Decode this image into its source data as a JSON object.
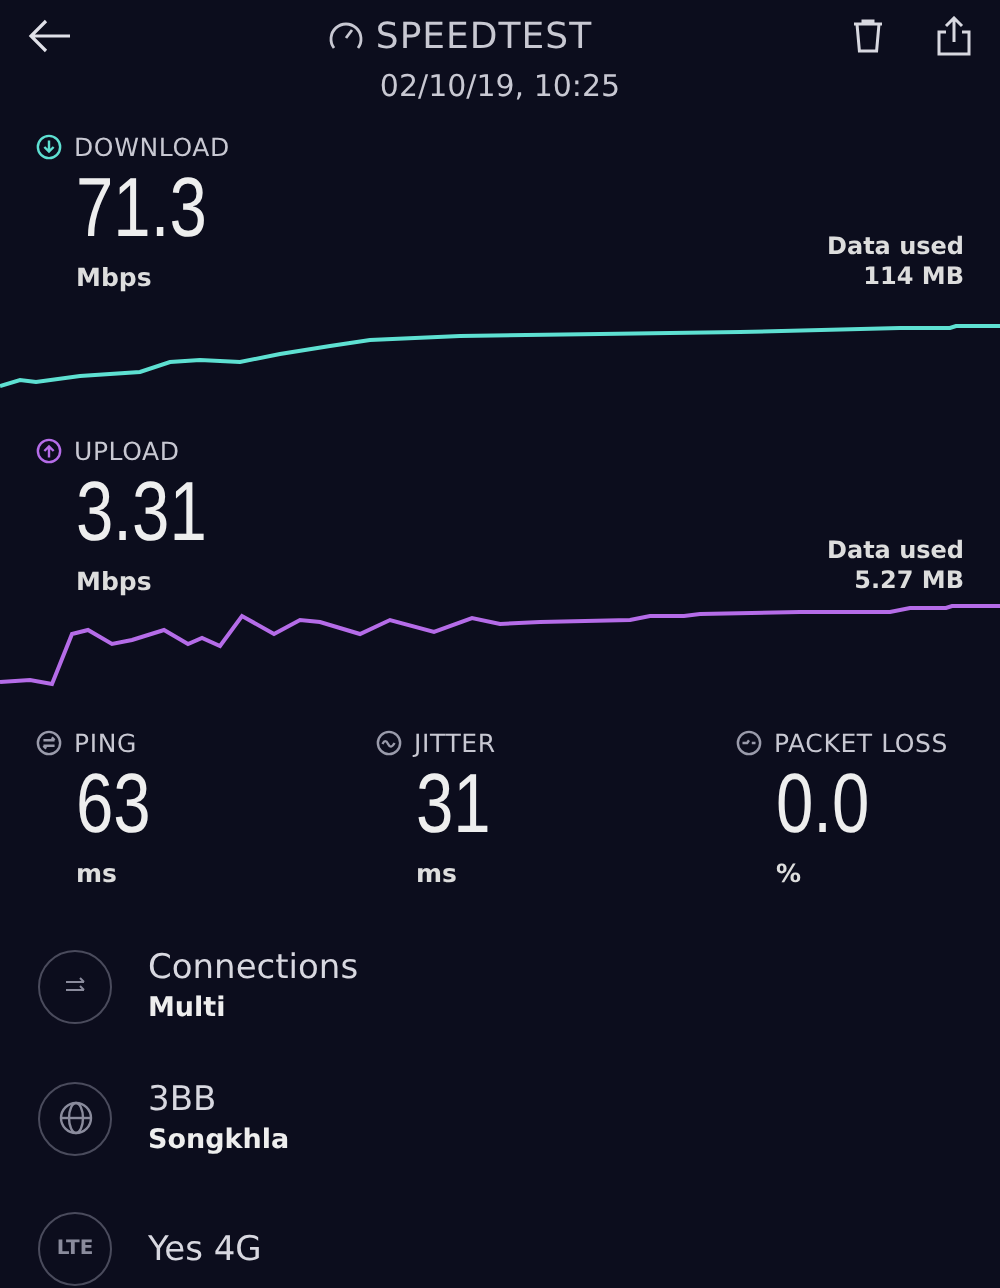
{
  "header": {
    "title": "SPEEDTEST",
    "date": "02/10/19, 10:25"
  },
  "speeds": [
    {
      "kind": "download",
      "label": "DOWNLOAD",
      "value": "71.3",
      "unit": "Mbps",
      "data_label": "Data used",
      "data_value": "114 MB"
    },
    {
      "kind": "upload",
      "label": "UPLOAD",
      "value": "3.31",
      "unit": "Mbps",
      "data_label": "Data used",
      "data_value": "5.27 MB"
    }
  ],
  "metrics": [
    {
      "kind": "ping",
      "label": "PING",
      "value": "63",
      "unit": "ms"
    },
    {
      "kind": "jitter",
      "label": "JITTER",
      "value": "31",
      "unit": "ms"
    },
    {
      "kind": "packet_loss",
      "label": "PACKET LOSS",
      "value": "0.0",
      "unit": "%"
    }
  ],
  "info": [
    {
      "kind": "connections",
      "title": "Connections",
      "detail": "Multi"
    },
    {
      "kind": "server",
      "title": "3BB",
      "detail": "Songkhla"
    },
    {
      "kind": "network",
      "icon_text": "LTE",
      "title": "Yes 4G"
    }
  ]
}
